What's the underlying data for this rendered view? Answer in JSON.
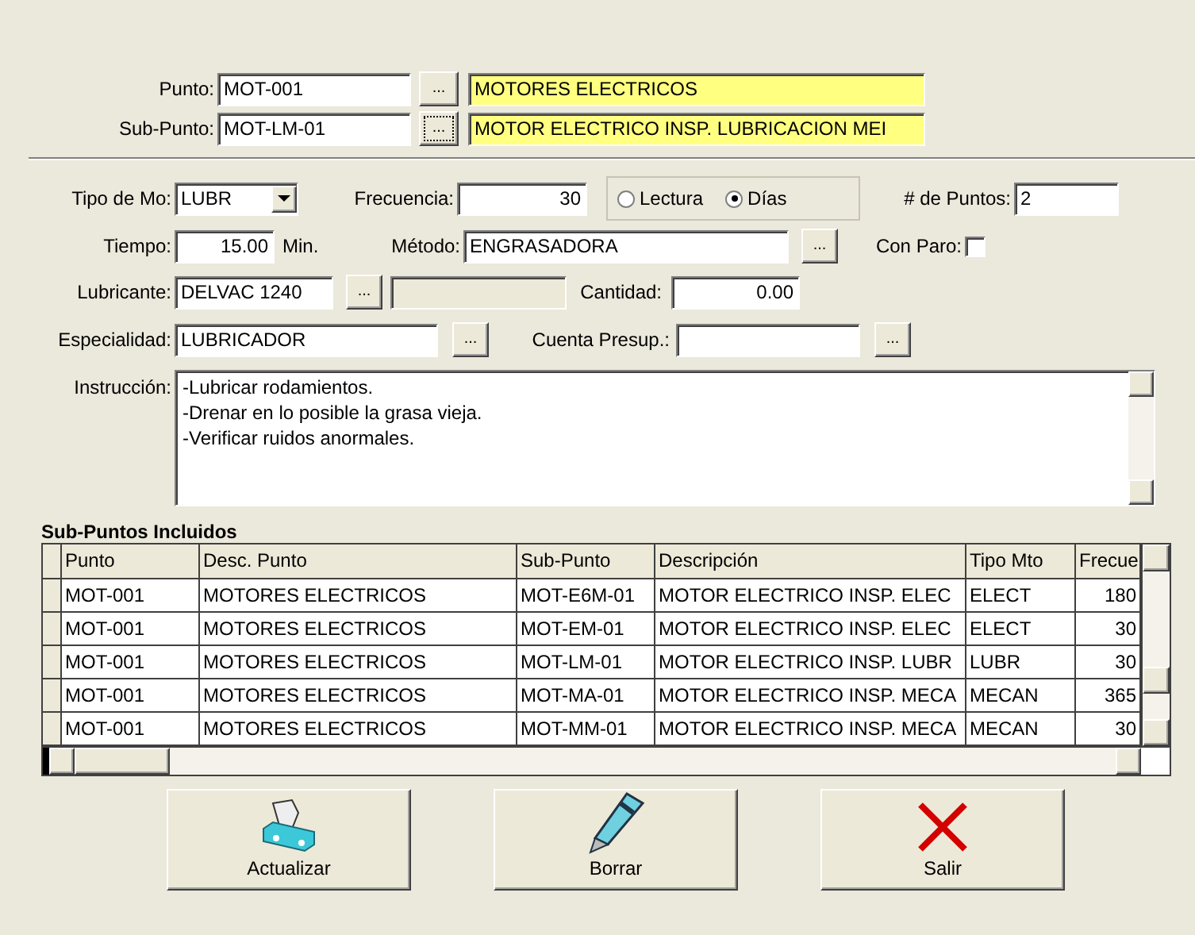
{
  "punto": {
    "label": "Punto:",
    "value": "MOT-001",
    "button": "...",
    "description": "MOTORES ELECTRICOS"
  },
  "sub_punto": {
    "label": "Sub-Punto:",
    "value": "MOT-LM-01",
    "button": "...",
    "description": "MOTOR ELECTRICO INSP. LUBRICACION MEI"
  },
  "tipo_mo": {
    "label": "Tipo de Mo:",
    "value": "LUBR"
  },
  "frecuencia": {
    "label": "Frecuencia:",
    "value": "30"
  },
  "frecuencia_unit": [
    {
      "label": "Lectura",
      "selected": false
    },
    {
      "label": "Días",
      "selected": true
    }
  ],
  "num_puntos": {
    "label": "# de Puntos:",
    "value": "2"
  },
  "tiempo": {
    "label": "Tiempo:",
    "value": "15.00",
    "unit": "Min."
  },
  "metodo": {
    "label": "Método:",
    "value": "ENGRASADORA",
    "button": "..."
  },
  "con_paro": {
    "label": "Con Paro:",
    "checked": false
  },
  "lubricante": {
    "label": "Lubricante:",
    "value": "DELVAC 1240",
    "button": "..."
  },
  "cantidad": {
    "label": "Cantidad:",
    "value": "0.00"
  },
  "especialidad": {
    "label": "Especialidad:",
    "value": "LUBRICADOR",
    "button": "..."
  },
  "cuenta_presup": {
    "label": "Cuenta Presup.:",
    "button": "..."
  },
  "instruccion": {
    "label": "Instrucción:",
    "lines": [
      "-Lubricar rodamientos.",
      "-Drenar en lo posible la grasa vieja.",
      "-Verificar ruidos anormales."
    ]
  },
  "table": {
    "title": "Sub-Puntos Incluidos",
    "columns": [
      "Punto",
      "Desc. Punto",
      "Sub-Punto",
      "Descripción",
      "Tipo Mto",
      "Frecue"
    ],
    "rows": [
      [
        "MOT-001",
        "MOTORES ELECTRICOS",
        "MOT-E6M-01",
        "MOTOR ELECTRICO INSP. ELEC",
        "ELECT",
        "180"
      ],
      [
        "MOT-001",
        "MOTORES ELECTRICOS",
        "MOT-EM-01",
        "MOTOR ELECTRICO INSP. ELEC",
        "ELECT",
        "30"
      ],
      [
        "MOT-001",
        "MOTORES ELECTRICOS",
        "MOT-LM-01",
        "MOTOR ELECTRICO INSP. LUBR",
        "LUBR",
        "30"
      ],
      [
        "MOT-001",
        "MOTORES ELECTRICOS",
        "MOT-MA-01",
        "MOTOR ELECTRICO INSP. MECA",
        "MECAN",
        "365"
      ],
      [
        "MOT-001",
        "MOTORES ELECTRICOS",
        "MOT-MM-01",
        "MOTOR ELECTRICO INSP. MECA",
        "MECAN",
        "30"
      ]
    ]
  },
  "buttons": [
    {
      "kind": "update",
      "label": "Actualizar"
    },
    {
      "kind": "erase",
      "label": "Borrar"
    },
    {
      "kind": "exit",
      "label": "Salir"
    }
  ]
}
